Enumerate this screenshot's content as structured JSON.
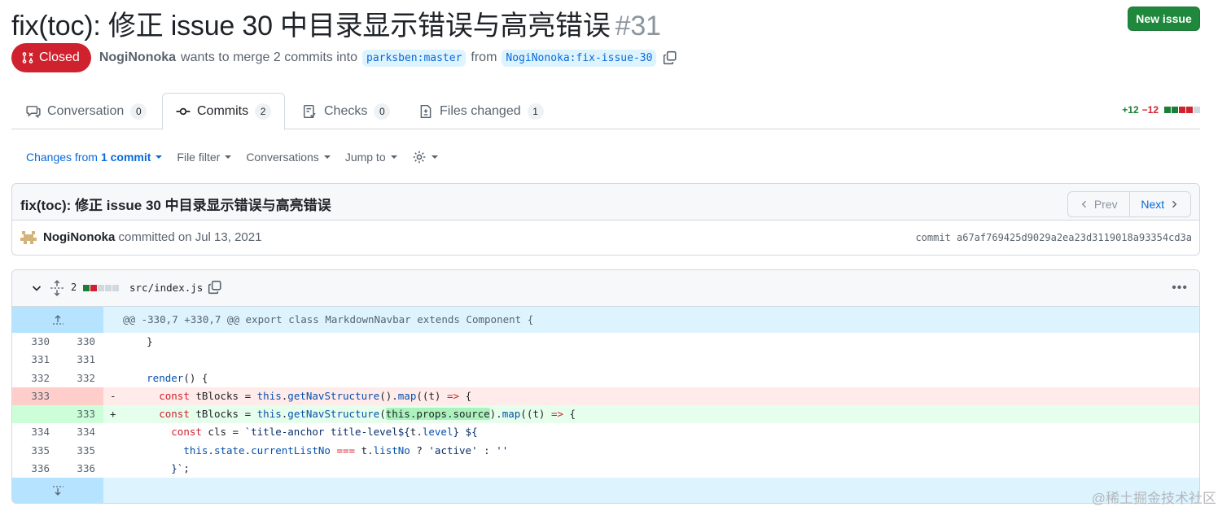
{
  "header": {
    "title": "fix(toc): 修正 issue 30 中目录显示错误与高亮错误",
    "number": "#31",
    "new_issue_label": "New issue"
  },
  "status": {
    "state": "Closed",
    "author": "NogiNonoka",
    "merge_text": "wants to merge 2 commits into",
    "base_branch": "parksben:master",
    "from_text": "from",
    "head_branch": "NogiNonoka:fix-issue-30"
  },
  "tabs": [
    {
      "label": "Conversation",
      "count": "0",
      "icon": "comment-icon"
    },
    {
      "label": "Commits",
      "count": "2",
      "icon": "git-commit-icon",
      "active": true
    },
    {
      "label": "Checks",
      "count": "0",
      "icon": "checklist-icon"
    },
    {
      "label": "Files changed",
      "count": "1",
      "icon": "file-diff-icon"
    }
  ],
  "diffstat": {
    "additions": "+12",
    "deletions": "−12"
  },
  "toolbar": {
    "changes_from": "Changes from",
    "changes_count": "1 commit",
    "file_filter": "File filter",
    "conversations": "Conversations",
    "jump_to": "Jump to"
  },
  "commit": {
    "title": "fix(toc): 修正 issue 30 中目录显示错误与高亮错误",
    "prev_label": "Prev",
    "next_label": "Next",
    "author": "NogiNonoka",
    "committed_text": "committed on Jul 13, 2021",
    "sha": "commit a67af769425d9029a2ea23d3119018a93354cd3a"
  },
  "file": {
    "changes": "2",
    "path": "src/index.js",
    "hunk_header": "@@ -330,7 +330,7 @@ export class MarkdownNavbar extends Component {",
    "lines": [
      {
        "old": "330",
        "new": "330",
        "sign": "",
        "type": "ctx",
        "code": "    }"
      },
      {
        "old": "331",
        "new": "331",
        "sign": "",
        "type": "ctx",
        "code": ""
      },
      {
        "old": "332",
        "new": "332",
        "sign": "",
        "type": "ctx",
        "code": "    render() {"
      },
      {
        "old": "333",
        "new": "",
        "sign": "-",
        "type": "del",
        "code": "      const tBlocks = this.getNavStructure().map((t) => {"
      },
      {
        "old": "",
        "new": "333",
        "sign": "+",
        "type": "add",
        "code": "      const tBlocks = this.getNavStructure(this.props.source).map((t) => {"
      },
      {
        "old": "334",
        "new": "334",
        "sign": "",
        "type": "ctx",
        "code": "        const cls = `title-anchor title-level${t.level} ${"
      },
      {
        "old": "335",
        "new": "335",
        "sign": "",
        "type": "ctx",
        "code": "          this.state.currentListNo === t.listNo ? 'active' : ''"
      },
      {
        "old": "336",
        "new": "336",
        "sign": "",
        "type": "ctx",
        "code": "        }`;"
      }
    ]
  },
  "watermark": "@稀土掘金技术社区",
  "colors": {
    "closed": "#cf222e",
    "new_issue": "#1f883d",
    "link": "#0969da"
  }
}
